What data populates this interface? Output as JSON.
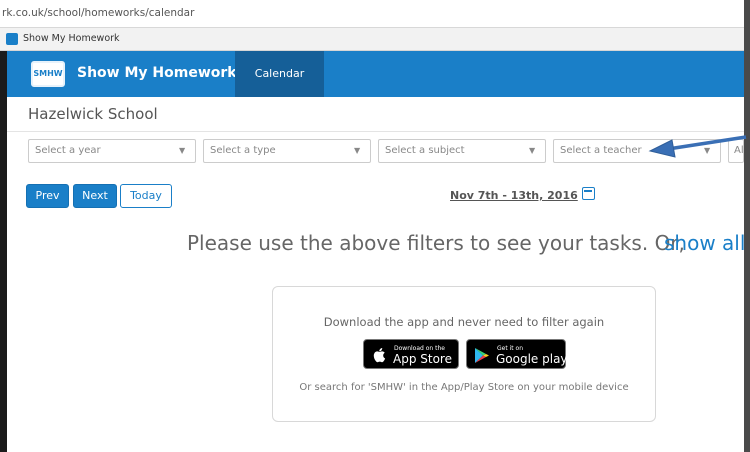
{
  "browser": {
    "url": "rk.co.uk/school/homeworks/calendar",
    "tab_title": "Show My Homework"
  },
  "navbar": {
    "logo_text": "SMHW",
    "brand": "Show My Homework",
    "tab_calendar": "Calendar"
  },
  "school": {
    "name": "Hazelwick School"
  },
  "filters": {
    "year": "Select a year",
    "type": "Select a type",
    "subject": "Select a subject",
    "teacher": "Select a teacher",
    "more": "All c"
  },
  "controls": {
    "prev": "Prev",
    "next": "Next",
    "today": "Today",
    "date_range": "Nov 7th - 13th, 2016"
  },
  "message": {
    "text": "Please use the above filters to see your tasks. Or,",
    "link": "show all"
  },
  "app_box": {
    "title": "Download the app and never need to filter again",
    "appstore_small": "Download on the",
    "appstore_big": "App Store",
    "googleplay_small": "Get it on",
    "googleplay_big": "Google play",
    "hint": "Or search for 'SMHW' in the App/Play Store on your mobile device"
  },
  "colors": {
    "brand_blue": "#1a7fc8",
    "nav_active": "#155f98",
    "annotation_arrow": "#3a6fb5"
  },
  "icons": [
    "calendar-icon",
    "apple-icon",
    "google-play-icon",
    "caret-down-icon",
    "smhw-logo-icon"
  ]
}
